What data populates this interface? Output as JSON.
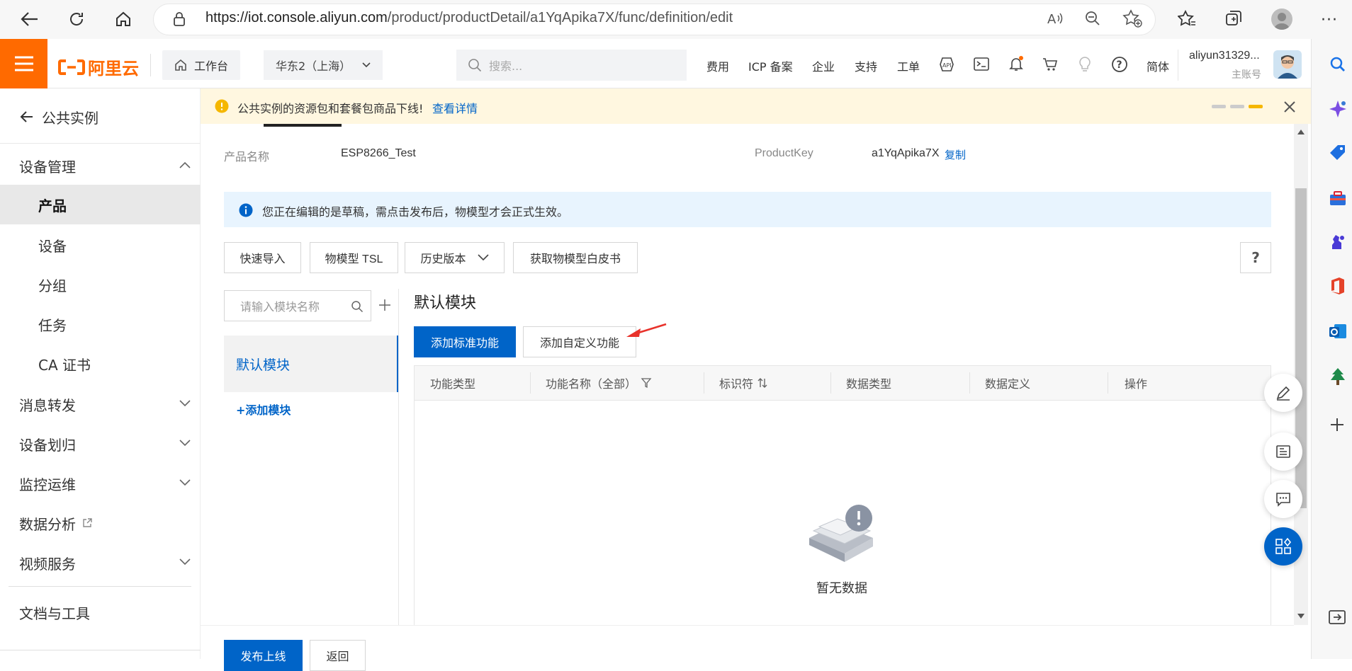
{
  "browser": {
    "url_host": "https://iot.console.aliyun.com",
    "url_path": "/product/productDetail/a1YqApika7X/func/definition/edit"
  },
  "topnav": {
    "logo_text": "阿里云",
    "workbench": "工作台",
    "region": "华东2（上海）",
    "search_placeholder": "搜索...",
    "links": [
      "费用",
      "ICP 备案",
      "企业",
      "支持",
      "工单"
    ],
    "language": "简体",
    "account_name": "aliyun31329...",
    "account_role": "主账号"
  },
  "sidebar": {
    "back_label": "公共实例",
    "device_mgmt": "设备管理",
    "items": [
      "产品",
      "设备",
      "分组",
      "任务",
      "CA 证书"
    ],
    "groups": [
      "消息转发",
      "设备划归",
      "监控运维",
      "数据分析",
      "视频服务"
    ],
    "docs": "文档与工具"
  },
  "notice": {
    "text": "公共实例的资源包和套餐包商品下线!",
    "link": "查看详情"
  },
  "product": {
    "name_label": "产品名称",
    "name_value": "ESP8266_Test",
    "key_label": "ProductKey",
    "key_value": "a1YqApika7X",
    "copy_label": "复制"
  },
  "draft_info": "您正在编辑的是草稿，需点击发布后，物模型才会正式生效。",
  "toolbar": {
    "quick_import": "快速导入",
    "tsl": "物模型 TSL",
    "history": "历史版本",
    "whitepaper": "获取物模型白皮书",
    "help": "?"
  },
  "modules": {
    "search_placeholder": "请输入模块名称",
    "default_module": "默认模块",
    "add_module": "+添加模块"
  },
  "main": {
    "title": "默认模块",
    "add_standard": "添加标准功能",
    "add_custom": "添加自定义功能",
    "columns": [
      "功能类型",
      "功能名称（全部）",
      "标识符",
      "数据类型",
      "数据定义",
      "操作"
    ],
    "empty_text": "暂无数据"
  },
  "footer": {
    "publish": "发布上线",
    "back": "返回"
  },
  "colors": {
    "brand_orange": "#ff6a00",
    "primary_blue": "#0064c8",
    "notice_bg": "#fff7e0",
    "info_bg": "#e8f4fe"
  }
}
